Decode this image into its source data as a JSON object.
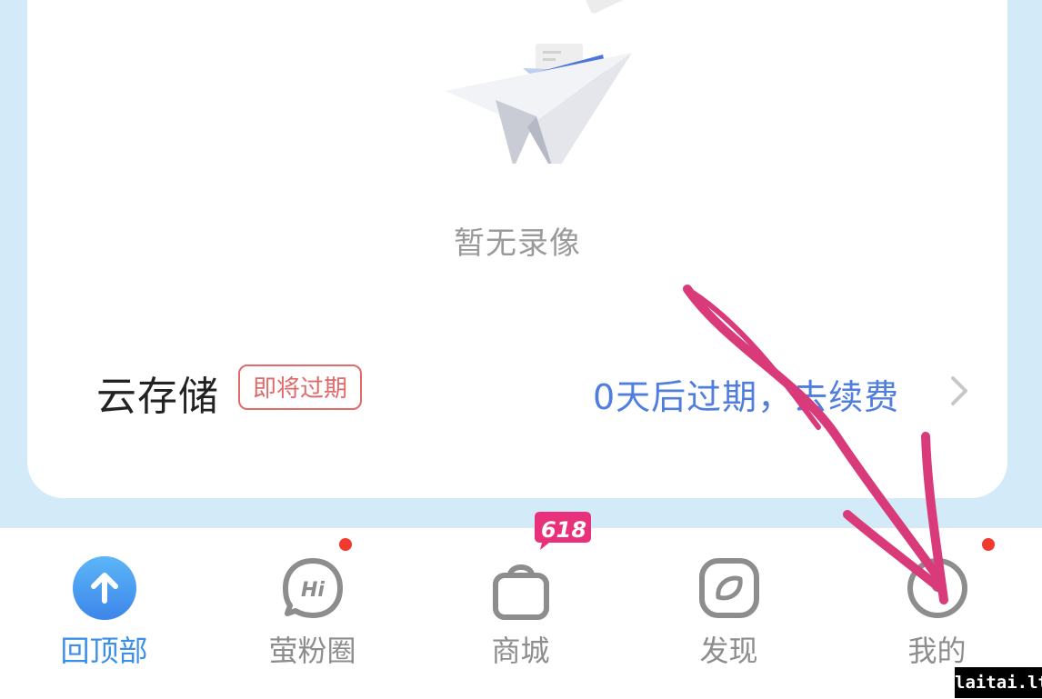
{
  "empty_state": {
    "message": "暂无录像",
    "icon": "paper-plane-folder-illustration"
  },
  "cloud_storage": {
    "title": "云存储",
    "badge": "即将过期",
    "renew_text": "0天后过期，去续费",
    "chevron_icon": "chevron-right-icon"
  },
  "tabbar": {
    "tabs": [
      {
        "label": "回顶部",
        "icon": "arrow-up-circle-icon",
        "active": true
      },
      {
        "label": "萤粉圈",
        "icon": "hi-chat-icon",
        "has_dot": true
      },
      {
        "label": "商城",
        "icon": "shopping-bag-icon",
        "promo_badge": "618"
      },
      {
        "label": "发现",
        "icon": "compass-icon"
      },
      {
        "label": "我的",
        "icon": "profile-icon",
        "has_dot": true
      }
    ]
  },
  "watermark": "laitai.ltd",
  "colors": {
    "background": "#d3ebf9",
    "accent_blue": "#3d8fe6",
    "link_blue": "#4f7ede",
    "badge_red": "#e06a6a",
    "dot_red": "#f03a2e",
    "promo_pink": "#e8317a",
    "annotation_pink": "#d83a7a"
  }
}
